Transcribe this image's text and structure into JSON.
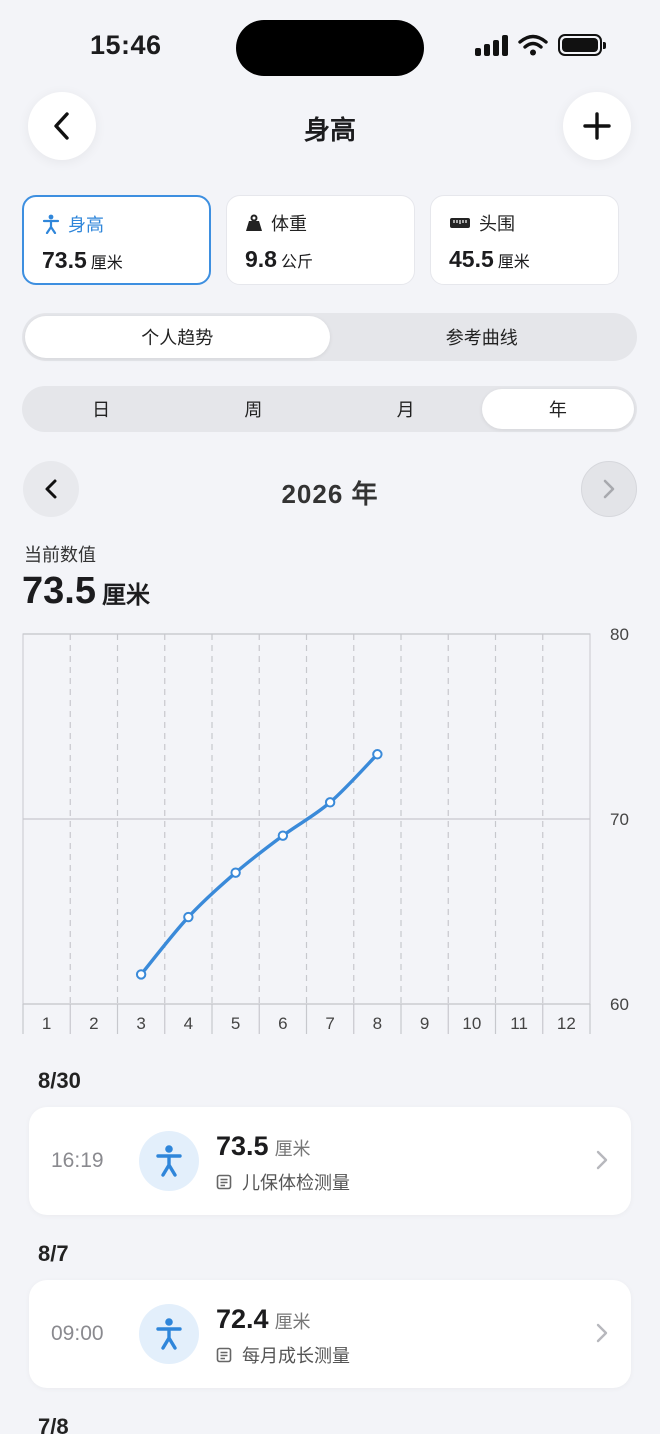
{
  "status": {
    "time": "15:46"
  },
  "nav": {
    "title": "身高"
  },
  "metrics": [
    {
      "label": "身高",
      "value": "73.5",
      "unit": "厘米",
      "icon": "person-icon",
      "active": true
    },
    {
      "label": "体重",
      "value": "9.8",
      "unit": "公斤",
      "icon": "weight-icon",
      "active": false
    },
    {
      "label": "头围",
      "value": "45.5",
      "unit": "厘米",
      "icon": "tape-measure-icon",
      "active": false
    }
  ],
  "view_tabs": [
    {
      "label": "个人趋势",
      "selected": true
    },
    {
      "label": "参考曲线",
      "selected": false
    }
  ],
  "period_tabs": [
    {
      "label": "日"
    },
    {
      "label": "周"
    },
    {
      "label": "月"
    },
    {
      "label": "年",
      "selected": true
    }
  ],
  "year_nav": {
    "title": "2026 年"
  },
  "current": {
    "label": "当前数值",
    "value": "73.5",
    "unit": "厘米"
  },
  "colors": {
    "accent": "#2f86da",
    "line": "#3a8ad9",
    "background": "#f3f4f8"
  },
  "chart_data": {
    "type": "line",
    "x_ticks": [
      "1",
      "2",
      "3",
      "4",
      "5",
      "6",
      "7",
      "8",
      "9",
      "10",
      "11",
      "12"
    ],
    "y_ticks": [
      "80",
      "70",
      "60"
    ],
    "ylim": [
      60,
      80
    ],
    "xlim": [
      1,
      12
    ],
    "grid": true,
    "series": [
      {
        "x": [
          3,
          4,
          5,
          6,
          7,
          8
        ],
        "y": [
          61.6,
          64.7,
          67.1,
          69.1,
          70.9,
          73.5
        ]
      }
    ]
  },
  "records": [
    {
      "date": "8/30",
      "time": "16:19",
      "value": "73.5",
      "unit": "厘米",
      "source": "儿保体检测量"
    },
    {
      "date": "8/7",
      "time": "09:00",
      "value": "72.4",
      "unit": "厘米",
      "source": "每月成长测量"
    },
    {
      "date": "7/8"
    }
  ]
}
